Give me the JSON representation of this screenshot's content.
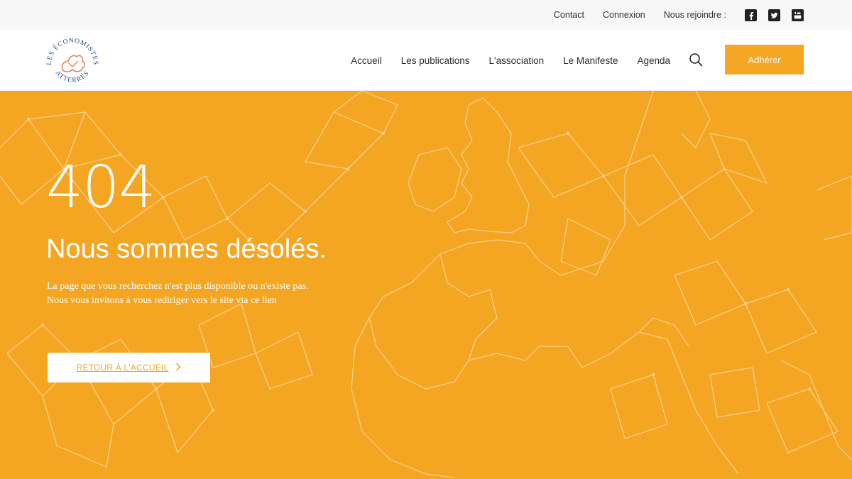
{
  "topbar": {
    "contact": "Contact",
    "login": "Connexion",
    "join_label": "Nous rejoindre :",
    "social": [
      "facebook-icon",
      "twitter-icon",
      "youtube-icon"
    ]
  },
  "header": {
    "logo_text_top": "LES ÉCONOMISTES",
    "logo_text_bottom": "ATTERRÉS",
    "nav": [
      "Accueil",
      "Les publications",
      "L'association",
      "Le Manifeste",
      "Agenda"
    ],
    "cta": "Adhérer"
  },
  "hero": {
    "code": "404",
    "title": "Nous sommes désolés.",
    "message": "La page que vous recherchez n'est plus disponible ou n'existe pas. Nous vous invitons à vous rediriger vers le site via ce lien",
    "button": "RETOUR À L'ACCUEIL",
    "button_icon": "chevron-right-icon"
  },
  "colors": {
    "accent": "#f4a622",
    "text": "#2b2b2b",
    "topbar_bg": "#f7f7f7"
  }
}
